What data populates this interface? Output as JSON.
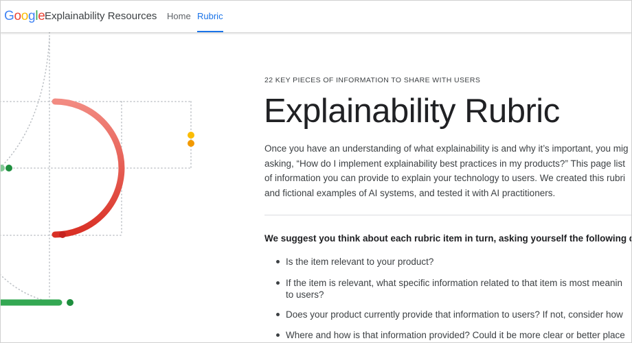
{
  "header": {
    "logo_letters": [
      {
        "ch": "G",
        "color": "#4285F4"
      },
      {
        "ch": "o",
        "color": "#EA4335"
      },
      {
        "ch": "o",
        "color": "#FBBC05"
      },
      {
        "ch": "g",
        "color": "#4285F4"
      },
      {
        "ch": "l",
        "color": "#34A853"
      },
      {
        "ch": "e",
        "color": "#EA4335"
      }
    ],
    "site_title": "Explainability Resources",
    "nav": [
      {
        "label": "Home",
        "active": false
      },
      {
        "label": "Rubric",
        "active": true
      }
    ]
  },
  "colors": {
    "accent": "#1a73e8",
    "arc_red": "#e53935",
    "green": "#1e8e3e",
    "yellow": "#fbbc04",
    "orange": "#f29900"
  },
  "main": {
    "eyebrow": "22 KEY PIECES OF INFORMATION TO SHARE WITH USERS",
    "title": "Explainability Rubric",
    "intro_lines": [
      "Once you have an understanding of what explainability is and why it’s important, you mig",
      "asking, “How do I implement explainability best practices in my products?” This page list",
      "of information you can provide to explain your technology to users. We created this rubri",
      "and fictional examples of AI systems, and tested it with AI practitioners."
    ],
    "prompt": "We suggest you think about each rubric item in turn, asking yourself the following que",
    "questions": [
      [
        "Is the item relevant to your product?"
      ],
      [
        "If the item is relevant, what specific information related to that item is most meanin",
        "to users?"
      ],
      [
        "Does your product currently provide that information to users? If not, consider how"
      ],
      [
        "Where and how is that information provided? Could it be more clear or better place"
      ]
    ]
  }
}
